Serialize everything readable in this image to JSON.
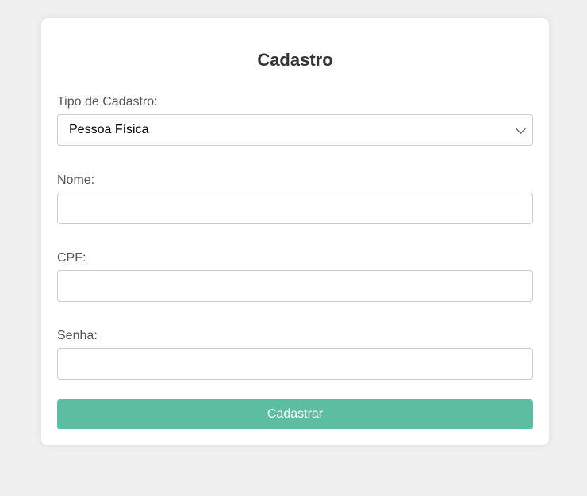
{
  "form": {
    "title": "Cadastro",
    "tipo_label": "Tipo de Cadastro:",
    "tipo_value": "Pessoa Física",
    "nome_label": "Nome:",
    "nome_value": "",
    "cpf_label": "CPF:",
    "cpf_value": "",
    "senha_label": "Senha:",
    "senha_value": "",
    "submit_label": "Cadastrar"
  },
  "colors": {
    "background": "#f0f0f0",
    "card": "#ffffff",
    "button": "#5cbda0",
    "button_text": "#ffffff",
    "label": "#555555",
    "title": "#333333"
  },
  "icons": {
    "select_arrow": "chevron-down-icon"
  }
}
